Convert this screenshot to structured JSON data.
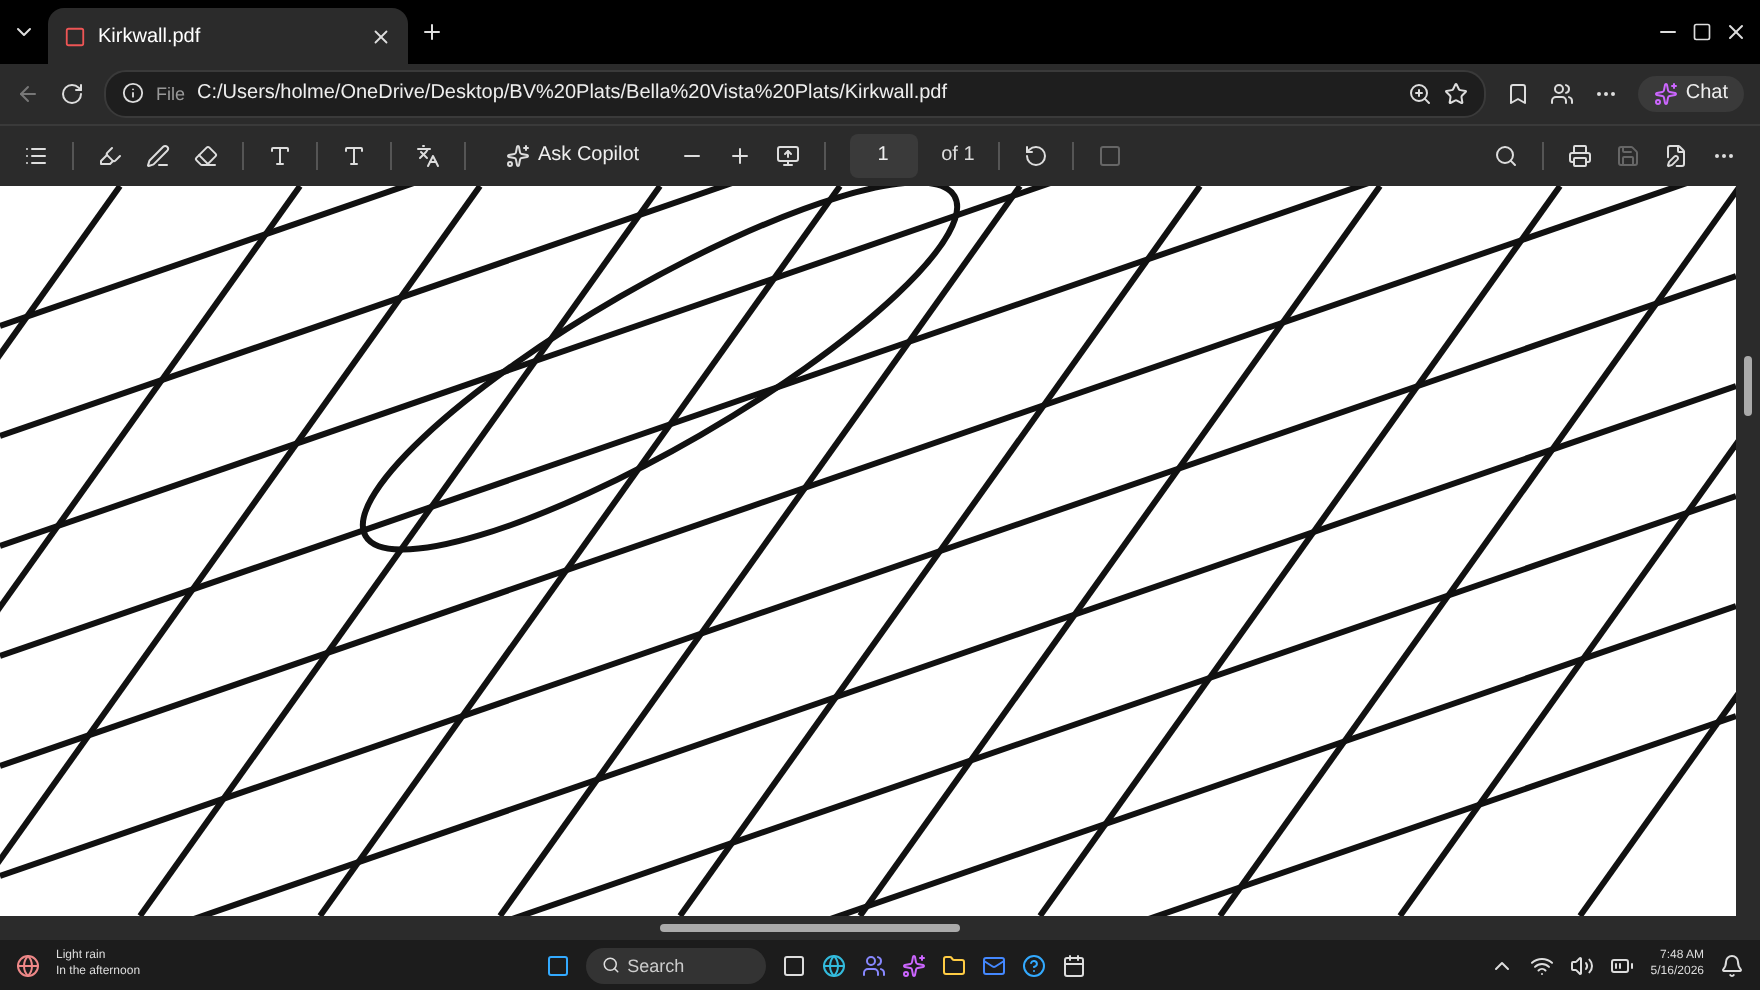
{
  "tabs": [
    {
      "title": "Kirkwall.pdf",
      "selected": true
    }
  ],
  "address_bar": {
    "scheme_label": "File",
    "url": "C:/Users/holme/OneDrive/Desktop/BV%20Plats/Bella%20Vista%20Plats/Kirkwall.pdf"
  },
  "chat_button": "Chat",
  "pdf_toolbar": {
    "copilot_label": "Ask Copilot",
    "page_number": "1",
    "page_count": "of 1"
  },
  "taskbar": {
    "weather": {
      "condition": "Light rain",
      "detail": "In the afternoon"
    },
    "search_placeholder": "Search",
    "time": "7:48 AM",
    "date": "5/16/2026"
  }
}
